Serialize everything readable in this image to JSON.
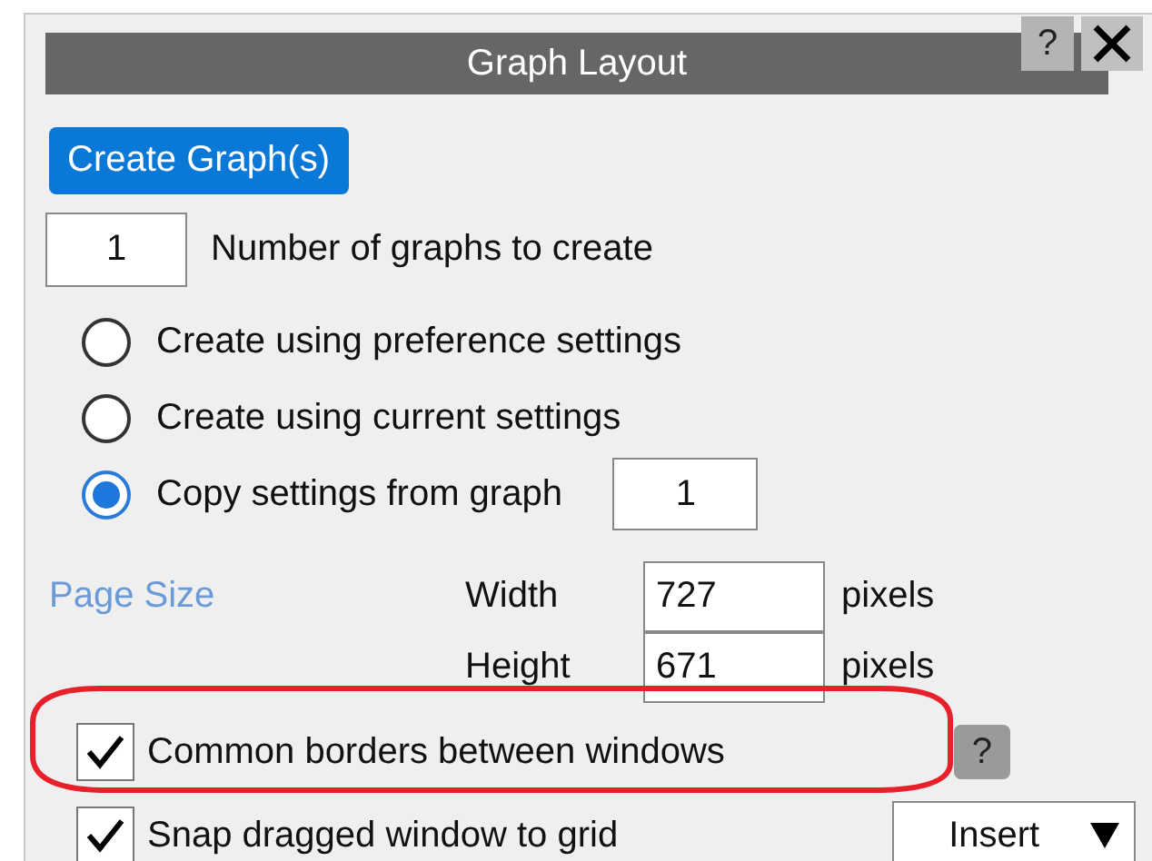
{
  "window": {
    "title": "Graph Layout",
    "help": "?"
  },
  "create_button": "Create Graph(s)",
  "graph_count": {
    "value": "1",
    "label": "Number of graphs to create"
  },
  "create_options": [
    {
      "label": "Create using preference settings",
      "selected": false
    },
    {
      "label": "Create using current settings",
      "selected": false
    },
    {
      "label": "Copy settings from graph",
      "selected": true,
      "value": "1"
    }
  ],
  "page_size": {
    "label": "Page Size",
    "rows": [
      {
        "label": "Width",
        "value": "727",
        "unit": "pixels"
      },
      {
        "label": "Height",
        "value": "671",
        "unit": "pixels"
      }
    ]
  },
  "options": [
    {
      "label": "Common borders between windows",
      "checked": true,
      "help": "?"
    },
    {
      "label": "Snap dragged window to grid",
      "checked": true,
      "dropdown": "Insert"
    }
  ]
}
